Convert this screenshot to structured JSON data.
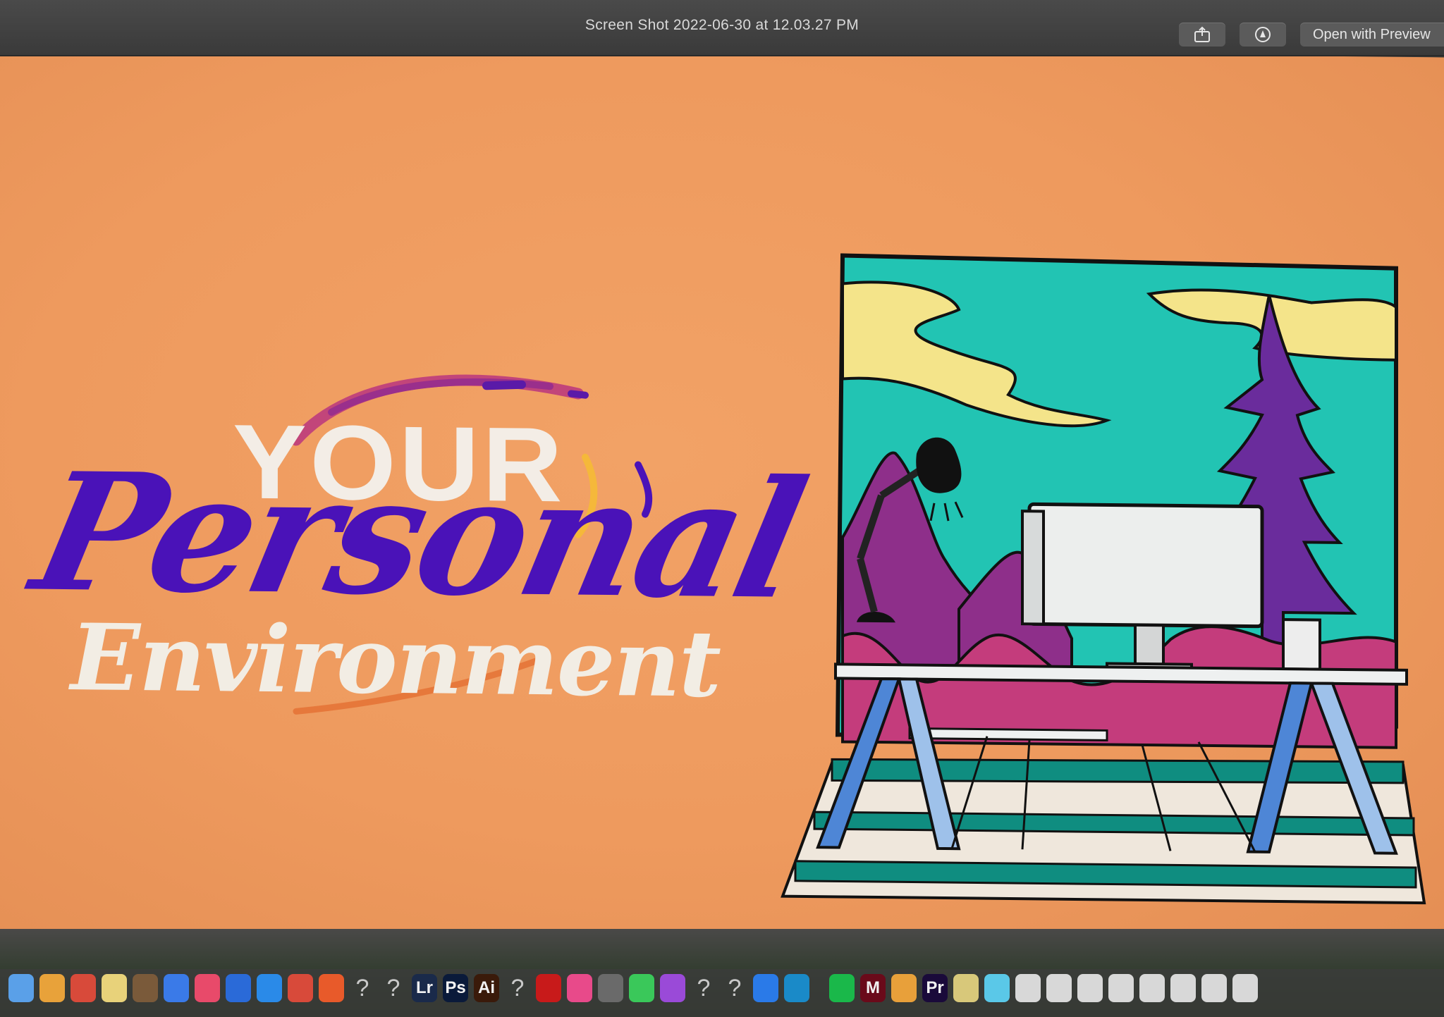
{
  "window": {
    "title": "Screen Shot 2022-06-30 at 12.03.27 PM",
    "share_icon": "share-icon",
    "markup_icon": "markup-icon",
    "open_button_label": "Open with Preview"
  },
  "slide": {
    "line1": "YOUR",
    "line2": "Personal",
    "line3": "Environment",
    "colors": {
      "background": "#ef9c60",
      "purple": "#4a12b8",
      "cream": "#f3ede6",
      "teal": "#22c4b3",
      "yellow": "#f4e48a",
      "violet": "#6a2c9c",
      "magenta": "#c43c7c"
    },
    "illustration_icon": "desk-workspace-illustration"
  },
  "dock": {
    "items": [
      {
        "icon": "finder-icon",
        "label": ""
      },
      {
        "icon": "photos-icon",
        "label": ""
      },
      {
        "icon": "chrome-icon",
        "label": ""
      },
      {
        "icon": "notes-icon",
        "label": ""
      },
      {
        "icon": "folder-icon",
        "label": ""
      },
      {
        "icon": "app-store-icon",
        "label": ""
      },
      {
        "icon": "music-icon",
        "label": ""
      },
      {
        "icon": "download-icon",
        "label": ""
      },
      {
        "icon": "safari-icon",
        "label": ""
      },
      {
        "icon": "chrome-icon",
        "label": ""
      },
      {
        "icon": "brave-icon",
        "label": ""
      },
      {
        "icon": "unknown-app-icon",
        "label": "?"
      },
      {
        "icon": "unknown-app-icon",
        "label": "?"
      },
      {
        "icon": "lightroom-icon",
        "label": "Lr"
      },
      {
        "icon": "photoshop-icon",
        "label": "Ps"
      },
      {
        "icon": "illustrator-icon",
        "label": "Ai"
      },
      {
        "icon": "unknown-app-icon",
        "label": "?"
      },
      {
        "icon": "acrobat-icon",
        "label": ""
      },
      {
        "icon": "creative-cloud-icon",
        "label": ""
      },
      {
        "icon": "screenshot-icon",
        "label": ""
      },
      {
        "icon": "messages-icon",
        "label": ""
      },
      {
        "icon": "podcasts-icon",
        "label": ""
      },
      {
        "icon": "unknown-app-icon",
        "label": "?"
      },
      {
        "icon": "unknown-app-icon",
        "label": "?"
      },
      {
        "icon": "zoom-icon",
        "label": ""
      },
      {
        "icon": "edge-icon",
        "label": ""
      },
      {
        "icon": "spotify-icon",
        "label": ""
      },
      {
        "icon": "app-icon",
        "label": "M"
      },
      {
        "icon": "pages-icon",
        "label": ""
      },
      {
        "icon": "premiere-icon",
        "label": "Pr"
      },
      {
        "icon": "archive-icon",
        "label": ""
      },
      {
        "icon": "preview-icon",
        "label": ""
      },
      {
        "icon": "document-icon",
        "label": ""
      },
      {
        "icon": "document-icon",
        "label": ""
      },
      {
        "icon": "document-icon",
        "label": ""
      },
      {
        "icon": "document-icon",
        "label": ""
      },
      {
        "icon": "document-icon",
        "label": ""
      },
      {
        "icon": "document-icon",
        "label": ""
      },
      {
        "icon": "document-icon",
        "label": ""
      },
      {
        "icon": "document-icon",
        "label": ""
      }
    ]
  }
}
